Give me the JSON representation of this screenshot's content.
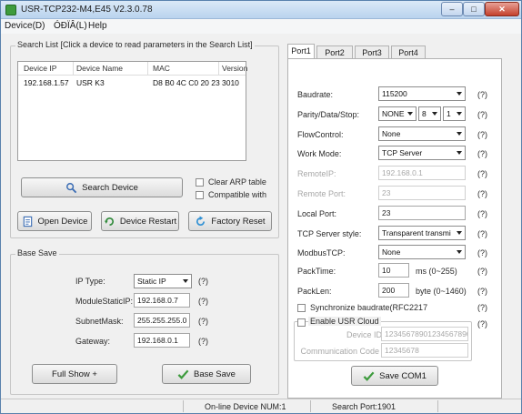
{
  "window": {
    "title": "USR-TCP232-M4,E45 V2.3.0.78",
    "controls": {
      "min": "–",
      "max": "□",
      "close": "✕"
    }
  },
  "menu": {
    "device": "Device(D)",
    "lang": "ÓÐÏÂ(L)",
    "help": "Help"
  },
  "search_list": {
    "title": "Search List [Click a device to read parameters in the Search List]",
    "headers": [
      "Device IP",
      "Device Name",
      "MAC",
      "Version"
    ],
    "rows": [
      [
        "192.168.1.57",
        "USR K3",
        "D8 B0 4C C0 20 23",
        "3010"
      ]
    ]
  },
  "buttons": {
    "search": "Search Device",
    "open": "Open Device",
    "restart": "Device Restart",
    "factory": "Factory Reset",
    "full_show": "Full Show +",
    "base_save": "Base Save",
    "save_com": "Save COM1"
  },
  "checks": {
    "clear_arp": "Clear ARP table",
    "compatible": "Compatible with"
  },
  "base_save": {
    "title": "Base Save",
    "ip_type_label": "IP   Type:",
    "ip_type_value": "Static IP",
    "static_ip_label": "ModuleStaticIP:",
    "static_ip_value": "192.168.0.7",
    "mask_label": "SubnetMask:",
    "mask_value": "255.255.255.0",
    "gateway_label": "Gateway:",
    "gateway_value": "192.168.0.1",
    "help": "(?)"
  },
  "tabs": [
    "Port1",
    "Port2",
    "Port3",
    "Port4"
  ],
  "port": {
    "baud_label": "Baudrate:",
    "baud_value": "115200",
    "parity_label": "Parity/Data/Stop:",
    "parity_value": "NONE",
    "data_value": "8",
    "stop_value": "1",
    "flow_label": "FlowControl:",
    "flow_value": "None",
    "mode_label": "Work Mode:",
    "mode_value": "TCP Server",
    "remote_ip_label": "RemoteIP:",
    "remote_ip_value": "192.168.0.1",
    "remote_port_label": "Remote Port:",
    "remote_port_value": "23",
    "local_port_label": "Local Port:",
    "local_port_value": "23",
    "tcp_style_label": "TCP Server style:",
    "tcp_style_value": "Transparent transmi",
    "modbus_label": "ModbusTCP:",
    "modbus_value": "None",
    "pack_time_label": "PackTime:",
    "pack_time_value": "10",
    "pack_time_unit": "ms (0~255)",
    "pack_len_label": "PackLen:",
    "pack_len_value": "200",
    "pack_len_unit": "byte (0~1460)",
    "sync_label": "Synchronize baudrate(RFC2217",
    "cloud_label": "Enable USR Cloud",
    "device_id_label": "Device ID",
    "device_id_value": "12345678901234567890",
    "comm_code_label": "Communication Code",
    "comm_code_value": "12345678",
    "help": "(?)"
  },
  "status": {
    "online": "On-line Device NUM:1",
    "search_port": "Search Port:1901"
  },
  "colors": {
    "accent": "#3d9b3d",
    "title_bar": "#b9d3ee",
    "close": "#c4412d"
  }
}
